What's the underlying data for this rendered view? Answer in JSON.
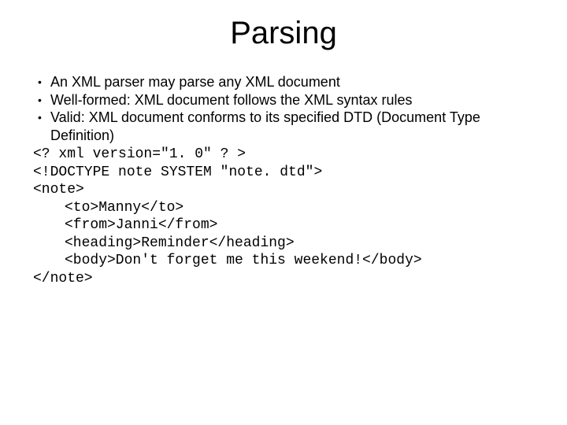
{
  "title": "Parsing",
  "bullets": [
    "An XML parser may parse any XML document",
    "Well-formed: XML document follows the XML syntax rules",
    "Valid: XML document conforms to its specified DTD (Document Type Definition)"
  ],
  "code": {
    "line1": "<? xml version=\"1. 0\" ? >",
    "line2": "<!DOCTYPE note SYSTEM \"note. dtd\">",
    "line3": "<note>",
    "line4": "<to>Manny</to>",
    "line5": "<from>Janni</from>",
    "line6": "<heading>Reminder</heading>",
    "line7": "<body>Don't forget me this weekend!</body>",
    "line8": "</note>"
  }
}
